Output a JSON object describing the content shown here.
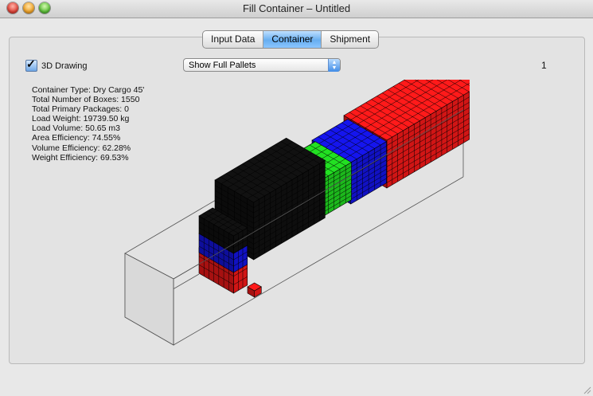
{
  "window": {
    "title": "Fill Container – Untitled"
  },
  "tabs": [
    {
      "label": "Input Data",
      "active": false
    },
    {
      "label": "Container",
      "active": true
    },
    {
      "label": "Shipment",
      "active": false
    }
  ],
  "controls": {
    "drawing_3d_label": "3D Drawing",
    "drawing_3d_checked": true,
    "view_select_value": "Show Full Pallets",
    "page_number": "1"
  },
  "stats": [
    "Container Type: Dry Cargo 45'",
    "Total Number of Boxes: 1550",
    "Total Primary Packages: 0",
    "Load Weight: 19739.50 kg",
    "Load Volume: 50.65 m3",
    "Area Efficiency: 74.55%",
    "Volume Efficiency: 62.28%",
    "Weight Efficiency: 69.53%"
  ],
  "colors": {
    "red": "#ff1a1a",
    "blue": "#1515ee",
    "green": "#22e022",
    "black": "#111111"
  }
}
